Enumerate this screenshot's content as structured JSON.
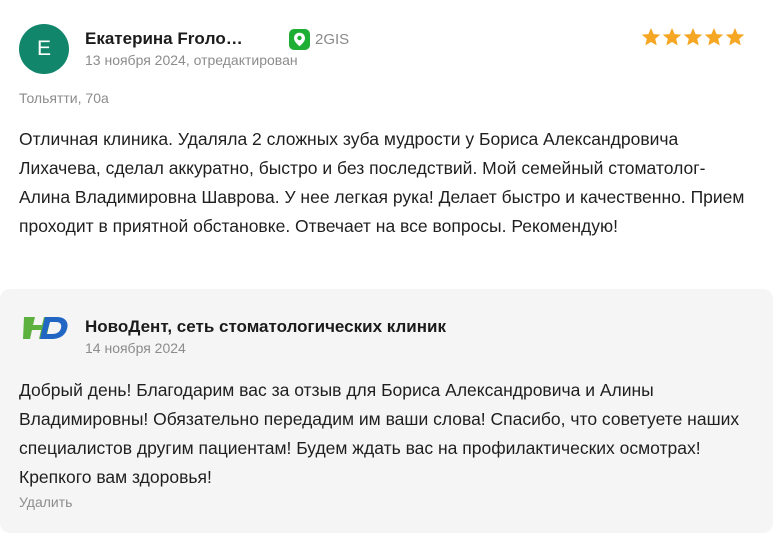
{
  "review": {
    "author": {
      "initial": "Е",
      "name": "Екатерина Froло…",
      "avatar_color": "#12866b"
    },
    "source": {
      "label": "2GIS",
      "icon": "2gis-icon",
      "color": "#1fae34"
    },
    "rating": {
      "stars": 5,
      "max": 5,
      "color": "#f5a623"
    },
    "date": "13 ноября 2024, отредактирован",
    "branch": "Тольятти, 70а",
    "text": "Отличная клиника. Удаляла 2 сложных зуба мудрости у Бориса Александровича Лихачева, сделал аккуратно, быстро и без последствий. Мой семейный стоматолог- Алина Владимировна Шаврова. У нее легкая рука! Делает быстро и качественно. Прием проходит в приятной обстановке. Отвечает на все вопросы. Рекомендую!"
  },
  "reply": {
    "author": "НовоДент, сеть стоматологических клиник",
    "logo": "novodent-logo",
    "date": "14 ноября 2024",
    "text": "Добрый день! Благодарим вас за отзыв для Бориса Александровича и Алины Владимировны! Обязательно передадим им ваши слова! Спасибо, что советуете наших специалистов другим пациентам! Будем ждать вас на профилактических осмотрах! Крепкого вам здоровья!",
    "delete_label": "Удалить"
  }
}
